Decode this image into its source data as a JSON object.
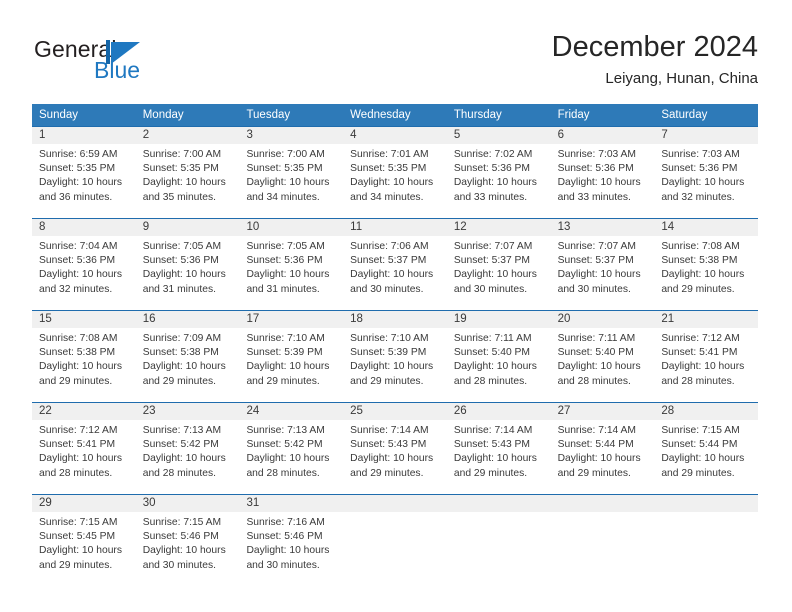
{
  "brand": {
    "name_part1": "General",
    "name_part2": "Blue",
    "mark_icon": "triangle-flag-icon",
    "accent_color": "#1f78c1"
  },
  "header": {
    "month_title": "December 2024",
    "location": "Leiyang, Hunan, China"
  },
  "calendar": {
    "header_color": "#2e7ab8",
    "day_band_color": "#f0f0f0",
    "weekdays": [
      "Sunday",
      "Monday",
      "Tuesday",
      "Wednesday",
      "Thursday",
      "Friday",
      "Saturday"
    ],
    "weeks": [
      {
        "days": [
          {
            "num": "1",
            "sunrise": "Sunrise: 6:59 AM",
            "sunset": "Sunset: 5:35 PM",
            "daylight1": "Daylight: 10 hours",
            "daylight2": "and 36 minutes."
          },
          {
            "num": "2",
            "sunrise": "Sunrise: 7:00 AM",
            "sunset": "Sunset: 5:35 PM",
            "daylight1": "Daylight: 10 hours",
            "daylight2": "and 35 minutes."
          },
          {
            "num": "3",
            "sunrise": "Sunrise: 7:00 AM",
            "sunset": "Sunset: 5:35 PM",
            "daylight1": "Daylight: 10 hours",
            "daylight2": "and 34 minutes."
          },
          {
            "num": "4",
            "sunrise": "Sunrise: 7:01 AM",
            "sunset": "Sunset: 5:35 PM",
            "daylight1": "Daylight: 10 hours",
            "daylight2": "and 34 minutes."
          },
          {
            "num": "5",
            "sunrise": "Sunrise: 7:02 AM",
            "sunset": "Sunset: 5:36 PM",
            "daylight1": "Daylight: 10 hours",
            "daylight2": "and 33 minutes."
          },
          {
            "num": "6",
            "sunrise": "Sunrise: 7:03 AM",
            "sunset": "Sunset: 5:36 PM",
            "daylight1": "Daylight: 10 hours",
            "daylight2": "and 33 minutes."
          },
          {
            "num": "7",
            "sunrise": "Sunrise: 7:03 AM",
            "sunset": "Sunset: 5:36 PM",
            "daylight1": "Daylight: 10 hours",
            "daylight2": "and 32 minutes."
          }
        ]
      },
      {
        "days": [
          {
            "num": "8",
            "sunrise": "Sunrise: 7:04 AM",
            "sunset": "Sunset: 5:36 PM",
            "daylight1": "Daylight: 10 hours",
            "daylight2": "and 32 minutes."
          },
          {
            "num": "9",
            "sunrise": "Sunrise: 7:05 AM",
            "sunset": "Sunset: 5:36 PM",
            "daylight1": "Daylight: 10 hours",
            "daylight2": "and 31 minutes."
          },
          {
            "num": "10",
            "sunrise": "Sunrise: 7:05 AM",
            "sunset": "Sunset: 5:36 PM",
            "daylight1": "Daylight: 10 hours",
            "daylight2": "and 31 minutes."
          },
          {
            "num": "11",
            "sunrise": "Sunrise: 7:06 AM",
            "sunset": "Sunset: 5:37 PM",
            "daylight1": "Daylight: 10 hours",
            "daylight2": "and 30 minutes."
          },
          {
            "num": "12",
            "sunrise": "Sunrise: 7:07 AM",
            "sunset": "Sunset: 5:37 PM",
            "daylight1": "Daylight: 10 hours",
            "daylight2": "and 30 minutes."
          },
          {
            "num": "13",
            "sunrise": "Sunrise: 7:07 AM",
            "sunset": "Sunset: 5:37 PM",
            "daylight1": "Daylight: 10 hours",
            "daylight2": "and 30 minutes."
          },
          {
            "num": "14",
            "sunrise": "Sunrise: 7:08 AM",
            "sunset": "Sunset: 5:38 PM",
            "daylight1": "Daylight: 10 hours",
            "daylight2": "and 29 minutes."
          }
        ]
      },
      {
        "days": [
          {
            "num": "15",
            "sunrise": "Sunrise: 7:08 AM",
            "sunset": "Sunset: 5:38 PM",
            "daylight1": "Daylight: 10 hours",
            "daylight2": "and 29 minutes."
          },
          {
            "num": "16",
            "sunrise": "Sunrise: 7:09 AM",
            "sunset": "Sunset: 5:38 PM",
            "daylight1": "Daylight: 10 hours",
            "daylight2": "and 29 minutes."
          },
          {
            "num": "17",
            "sunrise": "Sunrise: 7:10 AM",
            "sunset": "Sunset: 5:39 PM",
            "daylight1": "Daylight: 10 hours",
            "daylight2": "and 29 minutes."
          },
          {
            "num": "18",
            "sunrise": "Sunrise: 7:10 AM",
            "sunset": "Sunset: 5:39 PM",
            "daylight1": "Daylight: 10 hours",
            "daylight2": "and 29 minutes."
          },
          {
            "num": "19",
            "sunrise": "Sunrise: 7:11 AM",
            "sunset": "Sunset: 5:40 PM",
            "daylight1": "Daylight: 10 hours",
            "daylight2": "and 28 minutes."
          },
          {
            "num": "20",
            "sunrise": "Sunrise: 7:11 AM",
            "sunset": "Sunset: 5:40 PM",
            "daylight1": "Daylight: 10 hours",
            "daylight2": "and 28 minutes."
          },
          {
            "num": "21",
            "sunrise": "Sunrise: 7:12 AM",
            "sunset": "Sunset: 5:41 PM",
            "daylight1": "Daylight: 10 hours",
            "daylight2": "and 28 minutes."
          }
        ]
      },
      {
        "days": [
          {
            "num": "22",
            "sunrise": "Sunrise: 7:12 AM",
            "sunset": "Sunset: 5:41 PM",
            "daylight1": "Daylight: 10 hours",
            "daylight2": "and 28 minutes."
          },
          {
            "num": "23",
            "sunrise": "Sunrise: 7:13 AM",
            "sunset": "Sunset: 5:42 PM",
            "daylight1": "Daylight: 10 hours",
            "daylight2": "and 28 minutes."
          },
          {
            "num": "24",
            "sunrise": "Sunrise: 7:13 AM",
            "sunset": "Sunset: 5:42 PM",
            "daylight1": "Daylight: 10 hours",
            "daylight2": "and 28 minutes."
          },
          {
            "num": "25",
            "sunrise": "Sunrise: 7:14 AM",
            "sunset": "Sunset: 5:43 PM",
            "daylight1": "Daylight: 10 hours",
            "daylight2": "and 29 minutes."
          },
          {
            "num": "26",
            "sunrise": "Sunrise: 7:14 AM",
            "sunset": "Sunset: 5:43 PM",
            "daylight1": "Daylight: 10 hours",
            "daylight2": "and 29 minutes."
          },
          {
            "num": "27",
            "sunrise": "Sunrise: 7:14 AM",
            "sunset": "Sunset: 5:44 PM",
            "daylight1": "Daylight: 10 hours",
            "daylight2": "and 29 minutes."
          },
          {
            "num": "28",
            "sunrise": "Sunrise: 7:15 AM",
            "sunset": "Sunset: 5:44 PM",
            "daylight1": "Daylight: 10 hours",
            "daylight2": "and 29 minutes."
          }
        ]
      },
      {
        "days": [
          {
            "num": "29",
            "sunrise": "Sunrise: 7:15 AM",
            "sunset": "Sunset: 5:45 PM",
            "daylight1": "Daylight: 10 hours",
            "daylight2": "and 29 minutes."
          },
          {
            "num": "30",
            "sunrise": "Sunrise: 7:15 AM",
            "sunset": "Sunset: 5:46 PM",
            "daylight1": "Daylight: 10 hours",
            "daylight2": "and 30 minutes."
          },
          {
            "num": "31",
            "sunrise": "Sunrise: 7:16 AM",
            "sunset": "Sunset: 5:46 PM",
            "daylight1": "Daylight: 10 hours",
            "daylight2": "and 30 minutes."
          },
          {
            "num": "",
            "sunrise": "",
            "sunset": "",
            "daylight1": "",
            "daylight2": ""
          },
          {
            "num": "",
            "sunrise": "",
            "sunset": "",
            "daylight1": "",
            "daylight2": ""
          },
          {
            "num": "",
            "sunrise": "",
            "sunset": "",
            "daylight1": "",
            "daylight2": ""
          },
          {
            "num": "",
            "sunrise": "",
            "sunset": "",
            "daylight1": "",
            "daylight2": ""
          }
        ]
      }
    ]
  }
}
